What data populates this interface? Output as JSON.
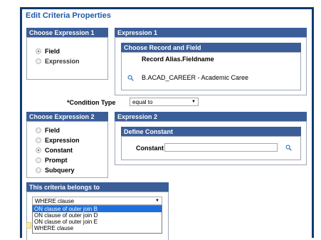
{
  "dialog": {
    "title": "Edit Criteria Properties"
  },
  "expr1_type": {
    "header": "Choose Expression 1 Type",
    "options": [
      {
        "label": "Field",
        "checked": true
      },
      {
        "label": "Expression",
        "checked": false
      }
    ]
  },
  "expr1": {
    "header": "Expression 1",
    "subheader": "Choose Record and Field",
    "column_label": "Record Alias.Fieldname",
    "field_value": "B.ACAD_CAREER - Academic Caree",
    "icon": "search-icon"
  },
  "condition": {
    "label": "*Condition Type",
    "value": "equal to"
  },
  "expr2_type": {
    "header": "Choose Expression 2 Type",
    "options": [
      {
        "label": "Field",
        "checked": false
      },
      {
        "label": "Expression",
        "checked": false
      },
      {
        "label": "Constant",
        "checked": true
      },
      {
        "label": "Prompt",
        "checked": false
      },
      {
        "label": "Subquery",
        "checked": false
      }
    ]
  },
  "expr2": {
    "header": "Expression 2",
    "subheader": "Define Constant",
    "constant_label": "Constant",
    "constant_value": "",
    "icon": "search-icon"
  },
  "belongs": {
    "header": "This criteria belongs to",
    "selected": "WHERE clause",
    "options": [
      "ON clause of outer join B",
      "ON clause of outer join D",
      "ON clause of outer join E",
      "WHERE clause"
    ],
    "highlighted_index": 0
  },
  "colors": {
    "header_bg": "#3b5e99",
    "frame": "#0f3b6e",
    "title": "#1f5aa6",
    "highlight": "#1e6fd9"
  }
}
